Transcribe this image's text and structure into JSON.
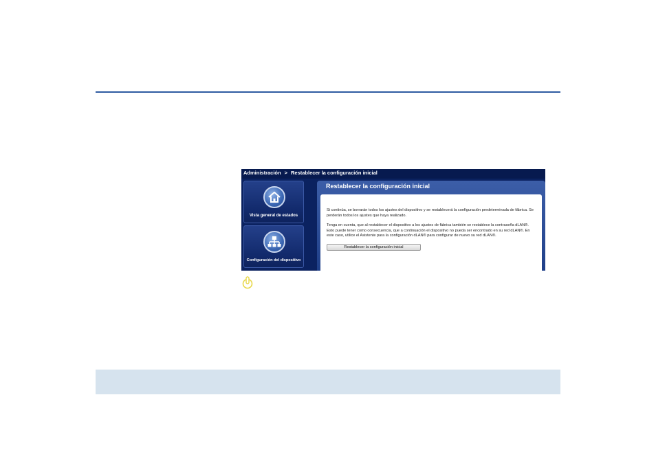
{
  "breadcrumb": {
    "section": "Administración",
    "separator": ">",
    "current": "Restablecer la configuración inicial"
  },
  "sidebar": {
    "tiles": [
      {
        "label": "Vista general de estados",
        "icon": "home-icon"
      },
      {
        "label": "Configuración del dispositivo",
        "icon": "network-icon"
      }
    ]
  },
  "panel": {
    "title": "Restablecer la configuración inicial",
    "paragraph1": "Si continúa, se borrarán todos los ajustes del dispositivo y se restablecerá la configuración predeterminada de fábrica. Se perderán todos los ajustes que haya realizado.",
    "paragraph2": "Tenga en cuenta, que al restablecer el dispositivo a los ajustes de fábrica también se restablece la contraseña dLAN®. Esto puede tener como consecuencia, que a continuación el dispositivo no pueda ser encontrado en su red dLAN®. En este caso, utilice el Asistente para la configuración dLAN® para configurar de nuevo su red dLAN®.",
    "button_label": "Restablecer la configuración inicial"
  },
  "colors": {
    "rule": "#2d5aa0",
    "band": "#d6e3ee",
    "ui_background": "#0b2260",
    "finger_icon": "#e8d84a"
  }
}
